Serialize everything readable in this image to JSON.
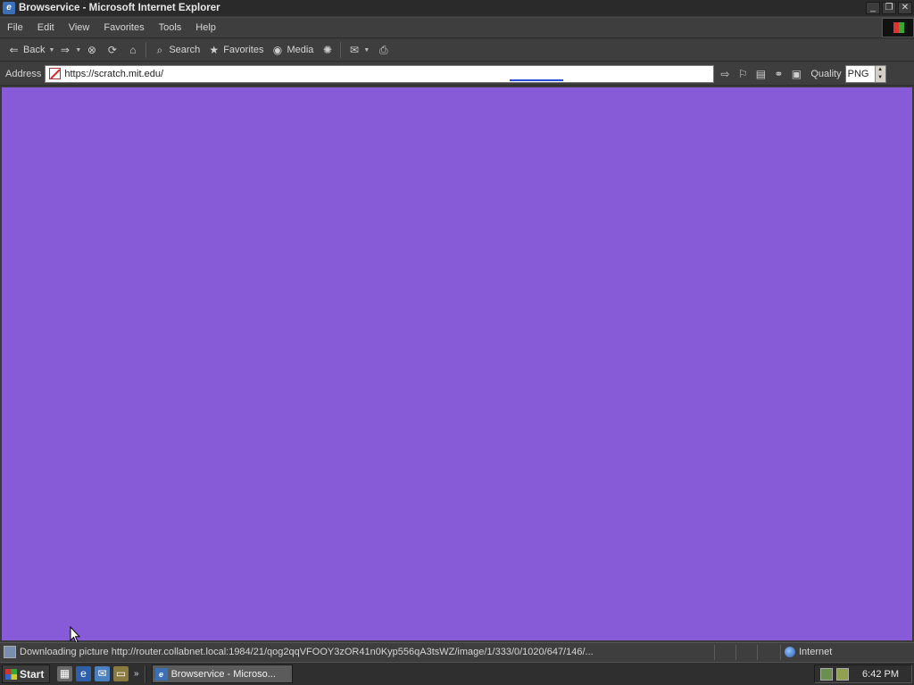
{
  "window": {
    "title": "Browservice - Microsoft Internet Explorer",
    "buttons": {
      "minimize": "_",
      "restore": "❐",
      "close": "✕"
    }
  },
  "menu": [
    "File",
    "Edit",
    "View",
    "Favorites",
    "Tools",
    "Help"
  ],
  "toolbar": {
    "back_label": "Back",
    "search_label": "Search",
    "favorites_label": "Favorites",
    "media_label": "Media"
  },
  "address": {
    "label": "Address",
    "url": "https://scratch.mit.edu/",
    "quality_label": "Quality",
    "quality_value": "PNG"
  },
  "content": {
    "background": "#875ad8"
  },
  "status": {
    "text": "Downloading picture http://router.collabnet.local:1984/21/qog2qqVFOOY3zOR41n0Kyp556qA3tsWZ/image/1/333/0/1020/647/146/...",
    "zone": "Internet"
  },
  "taskbar": {
    "start_label": "Start",
    "task_label": "Browservice - Microso...",
    "clock": "6:42 PM"
  }
}
